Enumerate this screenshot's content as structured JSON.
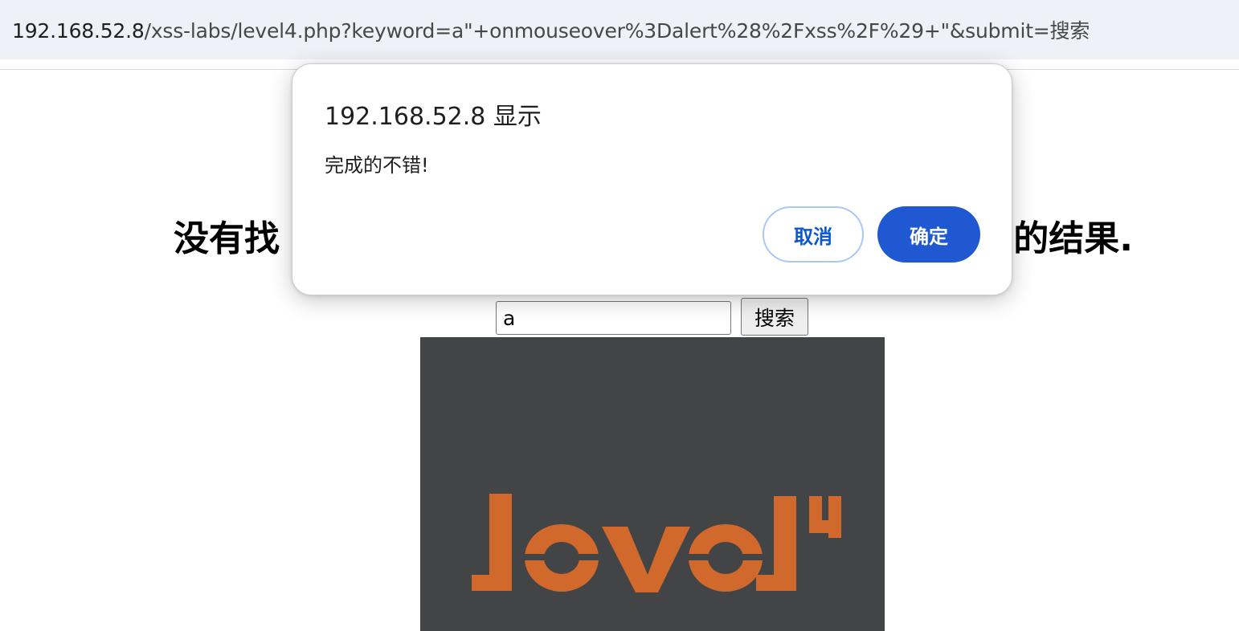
{
  "browser": {
    "url_host": "192.168.52.8",
    "url_rest": "/xss-labs/level4.php?keyword=a\"+onmouseover%3Dalert%28%2Fxss%2F%29+\"&submit=搜索"
  },
  "page": {
    "heading_visible_left": "没有找",
    "heading_visible_right": "的结果.",
    "search_value": "a",
    "search_button_label": "搜索",
    "image_logo_text": "level4",
    "image_colors": {
      "background": "#434446",
      "logo": "#d2692c"
    }
  },
  "dialog": {
    "title": "192.168.52.8 显示",
    "message": "完成的不错!",
    "cancel_label": "取消",
    "ok_label": "确定",
    "colors": {
      "ok_background": "#1f58d0",
      "cancel_text": "#0b57d0"
    }
  }
}
